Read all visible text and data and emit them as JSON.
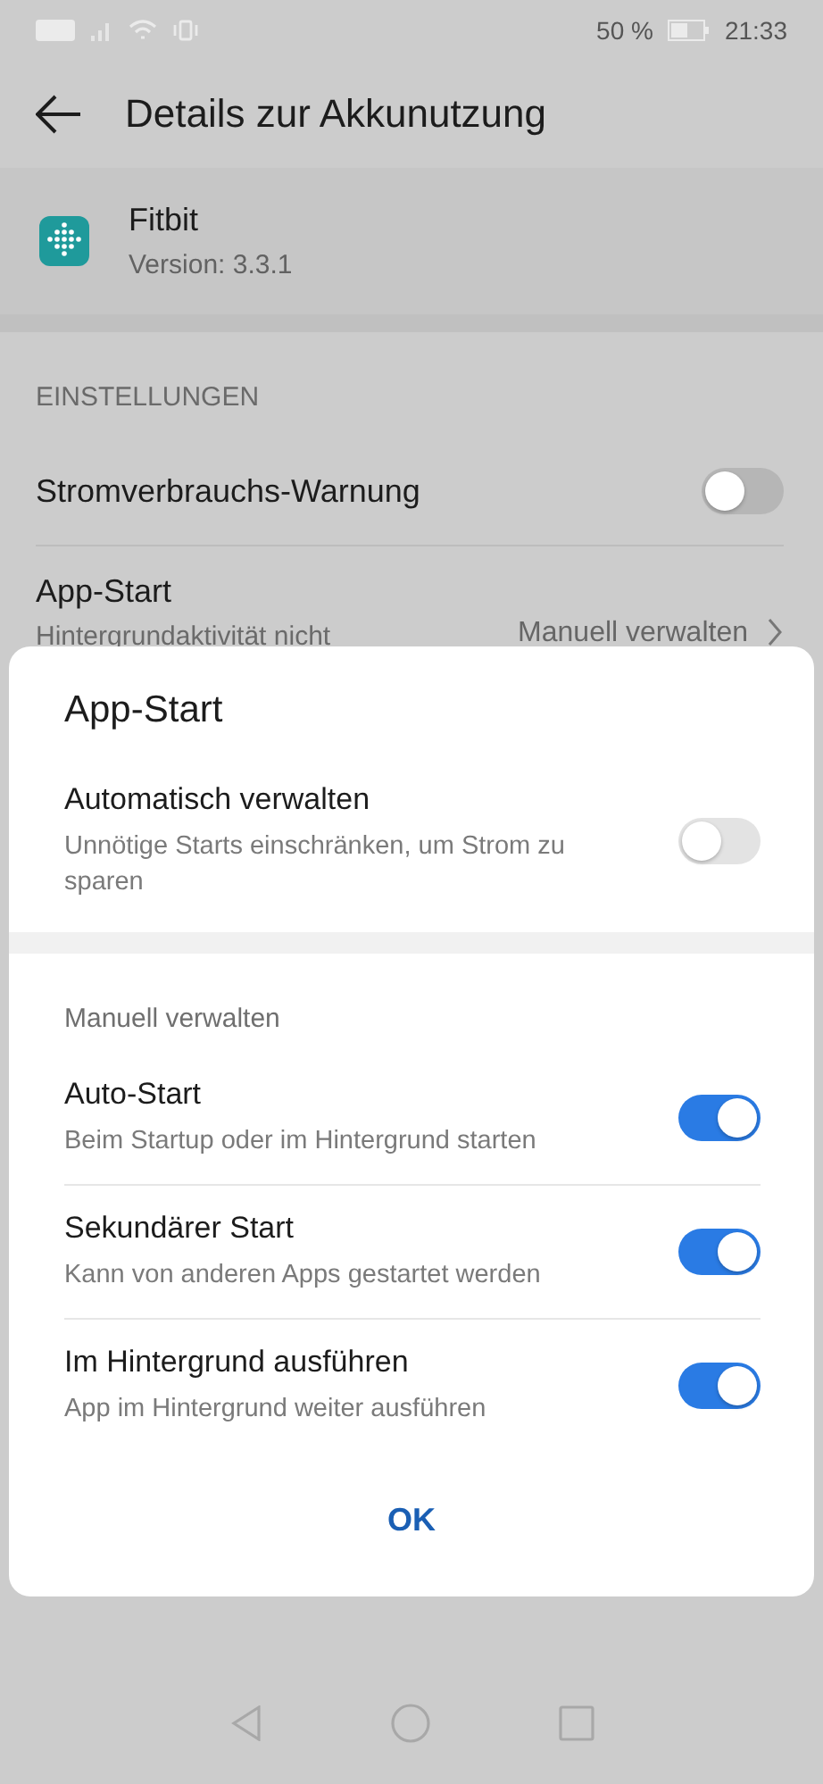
{
  "status_bar": {
    "battery": "50 %",
    "time": "21:33"
  },
  "header": {
    "title": "Details zur Akkunutzung"
  },
  "app": {
    "name": "Fitbit",
    "version": "Version: 3.3.1"
  },
  "section_label": "EINSTELLUNGEN",
  "settings": [
    {
      "kind": "toggle",
      "label": "Stromverbrauchs-Warnung",
      "on": false
    },
    {
      "kind": "link",
      "label": "App-Start",
      "subtitle": "Hintergrundaktivität nicht",
      "value": "Manuell verwalten"
    }
  ],
  "dialog": {
    "title": "App-Start",
    "auto": {
      "label": "Automatisch verwalten",
      "subtitle": "Unnötige Starts einschränken, um Strom zu sparen",
      "on": false
    },
    "manual_label": "Manuell verwalten",
    "options": [
      {
        "label": "Auto-Start",
        "subtitle": "Beim Startup oder im Hintergrund starten",
        "on": true
      },
      {
        "label": "Sekundärer Start",
        "subtitle": "Kann von anderen Apps gestartet werden",
        "on": true
      },
      {
        "label": "Im Hintergrund ausführen",
        "subtitle": "App im Hintergrund weiter ausführen",
        "on": true
      }
    ],
    "ok": "OK"
  }
}
